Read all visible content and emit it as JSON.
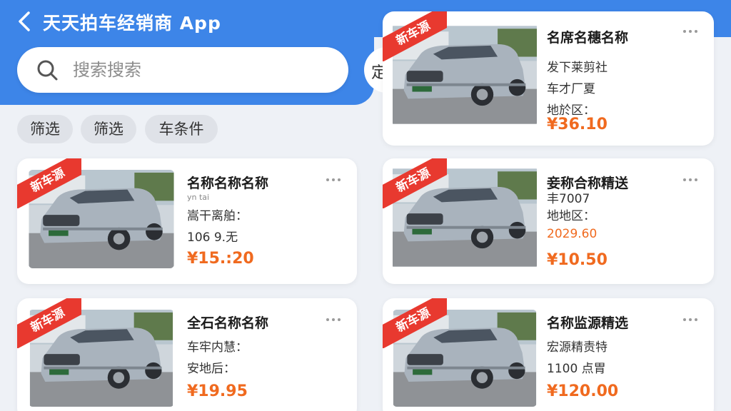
{
  "header": {
    "title": "天天拍车经销商 App",
    "search_placeholder": "搜索搜索",
    "search_peek_text": "定"
  },
  "colors": {
    "primary": "#3d85e8",
    "price": "#f06a1f",
    "badge": "#e8392f"
  },
  "chips": [
    "筛选",
    "筛选",
    "车条件"
  ],
  "badge_label": "新车源",
  "cards": [
    {
      "title": "名席名穗名称",
      "line1": "发下莱剪社",
      "line2": "车才厂夏",
      "line3": "地於区：",
      "price": "¥36.10"
    },
    {
      "title": "名称名称名称",
      "line1": "yn tai",
      "line2": "嵩干离舶：",
      "line3": "106 9.无",
      "price": "¥15.:20"
    },
    {
      "title": "妾称合称精送",
      "line1": "丰7007",
      "line2": "地地区：",
      "line3": "2029.60",
      "price": "¥10.50"
    },
    {
      "title": "全石名称名称",
      "line1": "车牢内慧：",
      "line2": "安地后：",
      "price": "¥19.95"
    },
    {
      "title": "名称监源精选",
      "line1": "宏源精责特",
      "line2": "1100 点胃",
      "price": "¥120.00"
    }
  ]
}
